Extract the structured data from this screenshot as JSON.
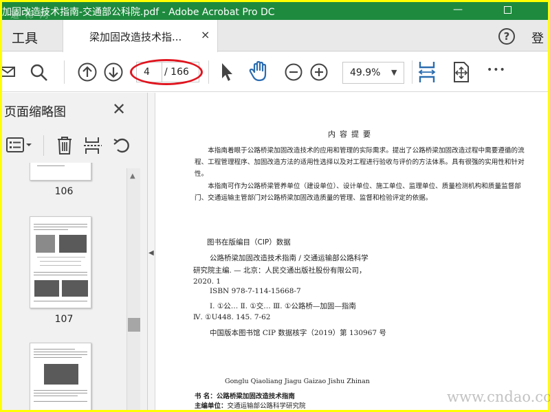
{
  "window": {
    "title": "加固改造技术指南-交通部公科院.pdf - Adobe Acrobat Pro DC",
    "title_overlay": "道 稀 网",
    "minimize_glyph": "—"
  },
  "tabs": {
    "tools_label": "工具",
    "document_tab_label": "梁加固改造技术指...",
    "close_glyph": "×",
    "help_glyph": "?",
    "login_label": "登"
  },
  "toolbar": {
    "current_page": "4",
    "total_pages": "/ 166",
    "zoom_value": "49.9%",
    "zoom_arrow": "▼",
    "more_glyph": "•••"
  },
  "sidebar": {
    "title": "页面缩略图",
    "close_glyph": "✕",
    "thumbnails": [
      {
        "label": "106"
      },
      {
        "label": "107"
      },
      {
        "label": ""
      }
    ]
  },
  "document": {
    "summary_title": "内容提要",
    "para1": "本指南着眼于公路桥梁加固改造技术的应用和管理的实际需求。提出了公路桥梁加固改造过程中需要遵循的流程、工程管理程序、加固改造方法的适用性选择以及对工程进行验收与评价的方法体系。具有很强的实用性和针对性。",
    "para2": "本指南可作为公路桥梁管养单位（建设单位）、设计单位、施工单位、监理单位、质量检测机构和质量监督部门、交通运输主管部门对公路桥梁加固改造质量的管理、监督和检验评定的依据。",
    "cip_title": "图书在版编目（CIP）数据",
    "cip_lines": [
      "公路桥梁加固改造技术指南 / 交通运输部公路科学",
      "研究院主编. — 北京：人民交通出版社股份有限公司，",
      "2020. 1",
      "ISBN  978-7-114-15668-7",
      "Ⅰ. ①公…   Ⅱ. ①交…   Ⅲ. ①公路桥—加固—指南",
      "Ⅳ. ①U448. 145. 7-62",
      "中国版本图书馆 CIP 数据核字（2019）第 130967 号"
    ],
    "pinyin": "Gonglu Qiaoliang Jiagu Gaizao Jishu Zhinan",
    "book_label": "书      名：",
    "book_name": "公路桥梁加固改造技术指南",
    "editor_label": "主编单位：",
    "editor_name": "交通运输部公路科学研究院"
  },
  "watermark": "www.cndao.com",
  "colors": {
    "titlebar": "#1e8a3e",
    "border": "#ffff00",
    "annotation": "#e0141e",
    "icon_blue": "#2b6cb0"
  }
}
